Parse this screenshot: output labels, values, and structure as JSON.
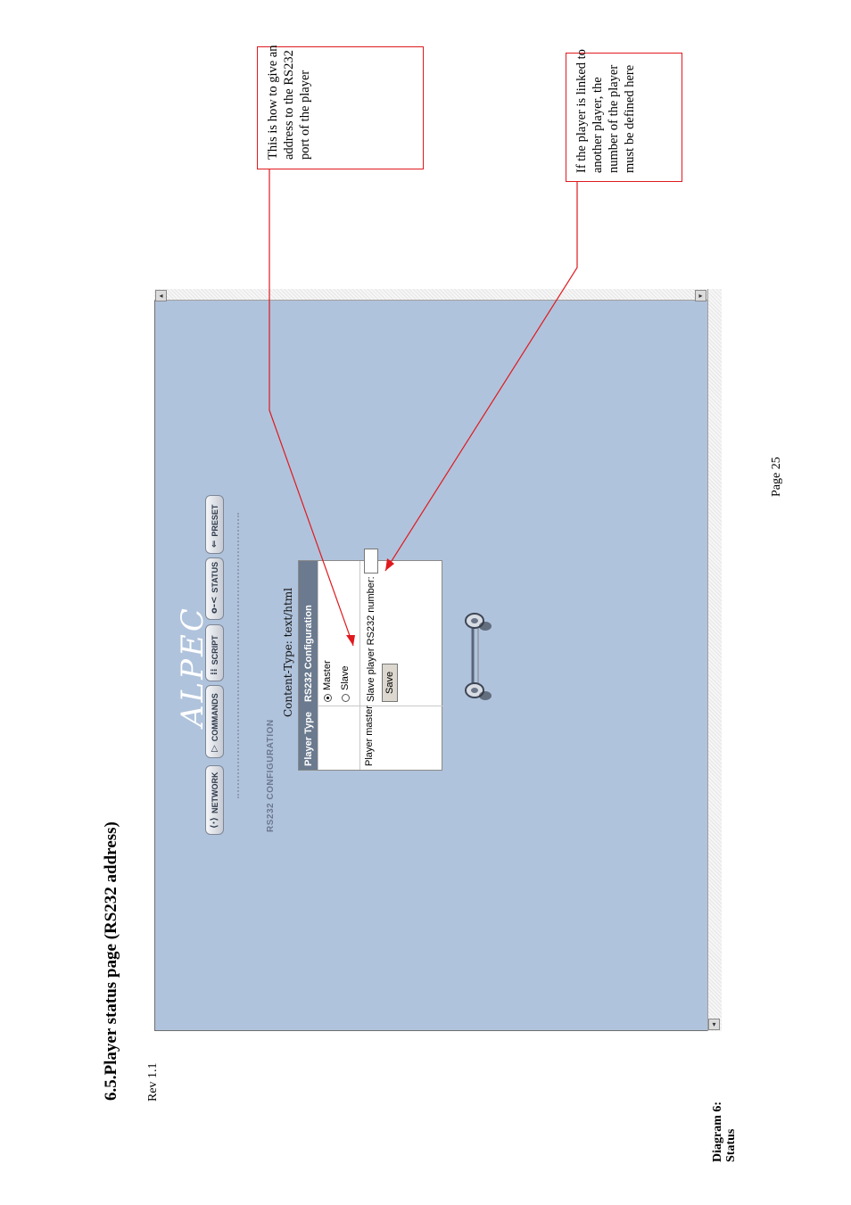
{
  "document": {
    "section_title": "6.5.Player status page (RS232 address)",
    "diagram_label": "Diagram 6:",
    "diagram_caption": "Status",
    "revision": "Rev 1.1",
    "page_number": "Page 25"
  },
  "callouts": {
    "rs232_address": "This is how to give an address to the RS232 port of the player",
    "linked_player": "If the player is linked to another player, the number of the player must be defined here"
  },
  "screenshot": {
    "logo": "ALPEC",
    "nav": [
      {
        "label": "NETWORK",
        "icon": "network-icon"
      },
      {
        "label": "COMMANDS",
        "icon": "commands-icon"
      },
      {
        "label": "SCRIPT",
        "icon": "script-icon"
      },
      {
        "label": "STATUS",
        "icon": "status-icon"
      },
      {
        "label": "PRESET",
        "icon": "preset-icon"
      }
    ],
    "page_heading": "RS232 CONFIGURATION",
    "content_type": "Content-Type: text/html",
    "form": {
      "header_col1": "Player Type",
      "header_col2": "RS232 Configuration",
      "option_master": "Master",
      "option_slave": "Slave",
      "selected": "Master",
      "row2_label": "Player master",
      "slave_number_label": "Slave player RS232 number:",
      "slave_number_value": "",
      "save_label": "Save"
    }
  },
  "colors": {
    "annotation": "#e0191e",
    "screen_background": "#b0c3dc"
  }
}
